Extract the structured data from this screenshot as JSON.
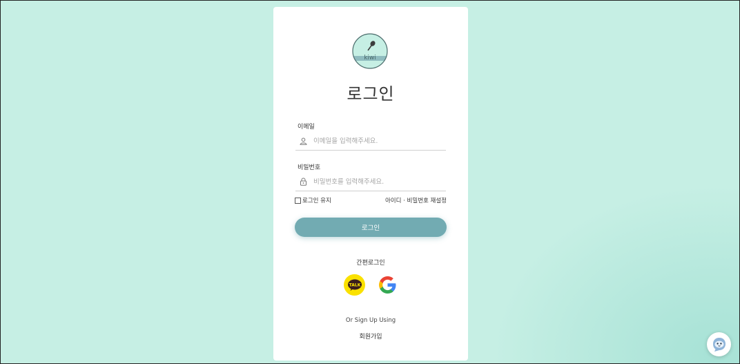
{
  "logo": {
    "text": "kiwi",
    "icon": "tennis-racket-icon"
  },
  "title": "로그인",
  "email": {
    "label": "이메일",
    "placeholder": "이메일을 입력해주세요.",
    "value": "",
    "icon": "user-icon"
  },
  "password": {
    "label": "비밀번호",
    "placeholder": "비밀번호를 입력해주세요.",
    "value": "",
    "icon": "lock-icon"
  },
  "remember": {
    "label": "로그인 유지",
    "checked": false
  },
  "reset_link": "아이디 · 비밀번호 재설정",
  "login_button": "로그인",
  "easy_login": {
    "label": "간편로그인",
    "kakao": {
      "text": "TALK",
      "icon": "kakao-talk-icon"
    },
    "google": {
      "icon": "google-icon"
    }
  },
  "signup": {
    "or_text": "Or Sign Up Using",
    "link": "회원가입"
  },
  "chat": {
    "icon": "chatbot-icon"
  },
  "colors": {
    "background": "#c6efe4",
    "accent": "#72abb2",
    "kakao": "#fae100",
    "logo_fill": "#c6efe4"
  }
}
